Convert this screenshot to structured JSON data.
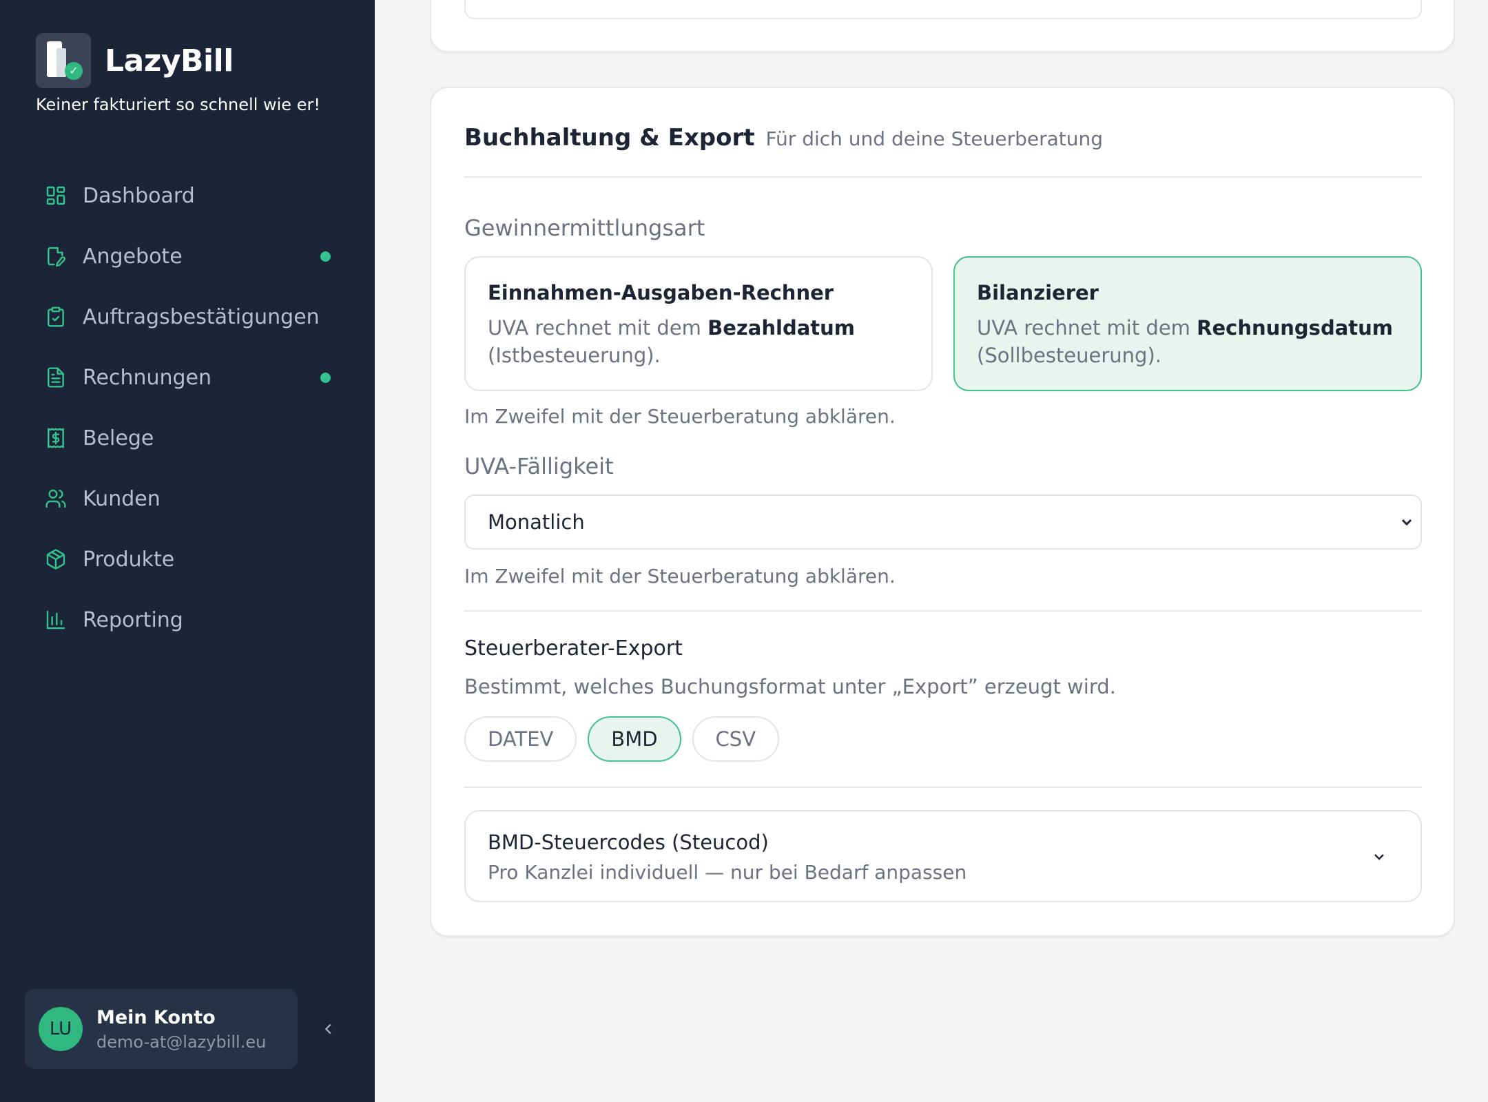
{
  "brand": {
    "name": "LazyBill",
    "tagline": "Keiner fakturiert so schnell wie er!"
  },
  "nav": [
    {
      "label": "Dashboard",
      "icon": "dashboard-icon",
      "dot": false
    },
    {
      "label": "Angebote",
      "icon": "document-pen-icon",
      "dot": true
    },
    {
      "label": "Auftragsbestätigungen",
      "icon": "clipboard-check-icon",
      "dot": false
    },
    {
      "label": "Rechnungen",
      "icon": "file-text-icon",
      "dot": true
    },
    {
      "label": "Belege",
      "icon": "receipt-dollar-icon",
      "dot": false
    },
    {
      "label": "Kunden",
      "icon": "users-icon",
      "dot": false
    },
    {
      "label": "Produkte",
      "icon": "package-icon",
      "dot": false
    },
    {
      "label": "Reporting",
      "icon": "bar-chart-icon",
      "dot": false
    }
  ],
  "account": {
    "initials": "LU",
    "name": "Mein Konto",
    "email": "demo-at@lazybill.eu"
  },
  "section": {
    "title": "Buchhaltung & Export",
    "subtitle": "Für dich und deine Steuerberatung",
    "profit_method": {
      "label": "Gewinnermittlungsart",
      "options": [
        {
          "title": "Einnahmen-Ausgaben-Rechner",
          "desc_pre": "UVA rechnet mit dem ",
          "desc_bold": "Bezahldatum",
          "desc_post": "(Istbesteuerung).",
          "selected": false
        },
        {
          "title": "Bilanzierer",
          "desc_pre": "UVA rechnet mit dem ",
          "desc_bold": "Rechnungsdatum",
          "desc_post": "(Sollbesteuerung).",
          "selected": true
        }
      ],
      "hint": "Im Zweifel mit der Steuerberatung abklären."
    },
    "uva": {
      "label": "UVA-Fälligkeit",
      "value": "Monatlich",
      "hint": "Im Zweifel mit der Steuerberatung abklären."
    },
    "export": {
      "heading": "Steuerberater-Export",
      "desc": "Bestimmt, welches Buchungsformat unter „Export” erzeugt wird.",
      "formats": [
        "DATEV",
        "BMD",
        "CSV"
      ],
      "selected": "BMD"
    },
    "bmd_codes": {
      "title": "BMD-Steuercodes (Steucod)",
      "subtitle": "Pro Kanzlei individuell — nur bei Bedarf anpassen"
    }
  },
  "colors": {
    "sidebar_bg": "#1b2537",
    "accent": "#34c38f",
    "selected_bg": "#e7f5ee"
  }
}
